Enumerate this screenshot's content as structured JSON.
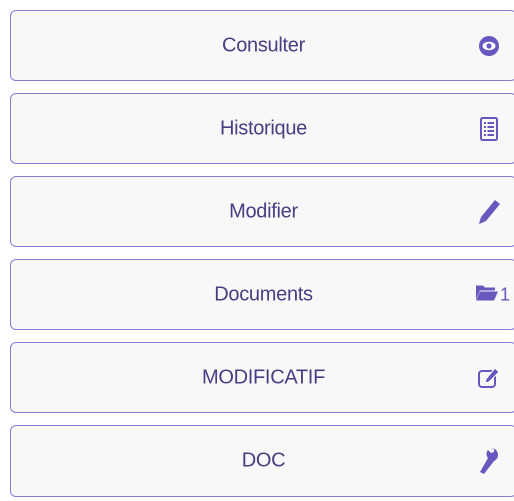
{
  "menu": {
    "items": [
      {
        "label": "Consulter",
        "icon": "eye-icon"
      },
      {
        "label": "Historique",
        "icon": "list-icon"
      },
      {
        "label": "Modifier",
        "icon": "pencil-icon"
      },
      {
        "label": "Documents",
        "icon": "folder-open-icon",
        "count": "1"
      },
      {
        "label": "MODIFICATIF",
        "icon": "edit-icon"
      },
      {
        "label": "DOC",
        "icon": "wrench-icon"
      }
    ]
  },
  "colors": {
    "accent": "#6a56bf",
    "border": "#8c7bd0",
    "text": "#4a3d82",
    "background": "#f8f8f8"
  }
}
